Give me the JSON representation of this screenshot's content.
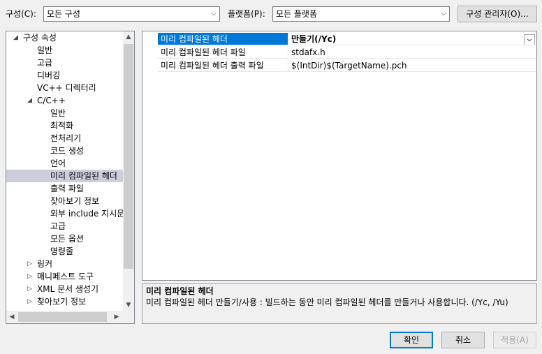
{
  "toolbar": {
    "config_label": "구성(C):",
    "config_value": "모든 구성",
    "platform_label": "플랫폼(P):",
    "platform_value": "모든 플랫폼",
    "config_manager_button": "구성 관리자(O)..."
  },
  "tree": {
    "items": [
      {
        "label": "구성 속성",
        "level": 0,
        "expander": "expanded"
      },
      {
        "label": "일반",
        "level": 1,
        "expander": "none"
      },
      {
        "label": "고급",
        "level": 1,
        "expander": "none"
      },
      {
        "label": "디버깅",
        "level": 1,
        "expander": "none"
      },
      {
        "label": "VC++ 디렉터리",
        "level": 1,
        "expander": "none"
      },
      {
        "label": "C/C++",
        "level": 1,
        "expander": "expanded"
      },
      {
        "label": "일반",
        "level": 2,
        "expander": "none"
      },
      {
        "label": "최적화",
        "level": 2,
        "expander": "none"
      },
      {
        "label": "전처리기",
        "level": 2,
        "expander": "none"
      },
      {
        "label": "코드 생성",
        "level": 2,
        "expander": "none"
      },
      {
        "label": "언어",
        "level": 2,
        "expander": "none"
      },
      {
        "label": "미리 컴파일된 헤더",
        "level": 2,
        "expander": "none",
        "selected": true
      },
      {
        "label": "출력 파일",
        "level": 2,
        "expander": "none"
      },
      {
        "label": "찾아보기 정보",
        "level": 2,
        "expander": "none"
      },
      {
        "label": "외부 include 지시문",
        "level": 2,
        "expander": "none"
      },
      {
        "label": "고급",
        "level": 2,
        "expander": "none"
      },
      {
        "label": "모든 옵션",
        "level": 2,
        "expander": "none"
      },
      {
        "label": "명령줄",
        "level": 2,
        "expander": "none"
      },
      {
        "label": "링커",
        "level": 1,
        "expander": "collapsed"
      },
      {
        "label": "매니페스트 도구",
        "level": 1,
        "expander": "collapsed"
      },
      {
        "label": "XML 문서 생성기",
        "level": 1,
        "expander": "collapsed"
      },
      {
        "label": "찾아보기 정보",
        "level": 1,
        "expander": "collapsed"
      }
    ]
  },
  "grid": {
    "rows": [
      {
        "name": "미리 컴파일된 헤더",
        "value": "만들기(/Yc)",
        "selected": true
      },
      {
        "name": "미리 컴파일된 헤더 파일",
        "value": "stdafx.h"
      },
      {
        "name": "미리 컴파일된 헤더 출력 파일",
        "value": "$(IntDir)$(TargetName).pch"
      }
    ]
  },
  "description": {
    "title": "미리 컴파일된 헤더",
    "text": "미리 컴파일된 헤더 만들기/사용 : 빌드하는 동안 미리 컴파일된 헤더를 만들거나 사용합니다.     (/Yc, /Yu)"
  },
  "buttons": {
    "ok": "확인",
    "cancel": "취소",
    "apply": "적용(A)"
  },
  "colors": {
    "selected_tree_bg": "#cccedb",
    "selected_grid_bg": "#0078d7",
    "primary_border": "#0078d7"
  }
}
